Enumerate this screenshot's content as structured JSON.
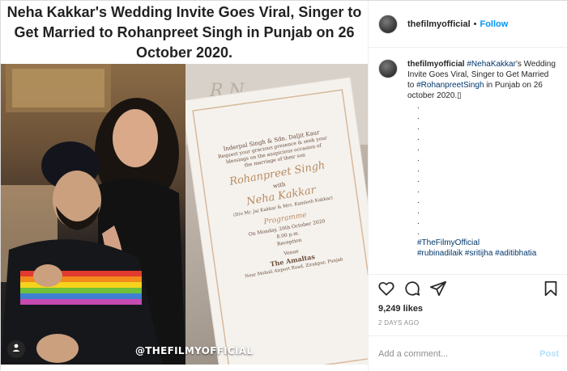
{
  "post": {
    "headline": "Neha Kakkar's Wedding Invite Goes Viral, Singer to Get Married to Rohanpreet Singh in Punjab on 26 October 2020.",
    "watermark": "@THEFILMYOFFICIAL",
    "invite_text": {
      "line1": "Inderpal Singh & Sdn. Daljit Kaur",
      "line2": "Request your gracious presence & seek your",
      "line3": "blessings on the auspicious occasion of",
      "line4": "the marriage of their son",
      "groom": "Rohanpreet Singh",
      "with": "with",
      "bride": "Neha Kakkar",
      "bride_parents": "(D/o Mr. Jai Kakkar & Mrs. Kamlesh Kakkar)",
      "programme": "Programme",
      "date_line": "On Monday, 26th October 2020",
      "time": "8.00 p.m.",
      "reception": "Reception",
      "venue_label": "Venue",
      "venue": "The Amaltas",
      "address": "Near Mohali Airport Road, Zirakpur, Punjab"
    }
  },
  "header": {
    "username": "thefilmyofficial",
    "separator": "•",
    "follow_label": "Follow"
  },
  "caption": {
    "username": "thefilmyofficial",
    "hashtag1": "#NehaKakkar",
    "text1": "'s Wedding Invite Goes Viral, Singer to Get Married to ",
    "hashtag2": "#RohanpreetSingh",
    "text2": " in Punjab on 26 october 2020.",
    "emoji_box": "▯",
    "dots": [
      ".",
      ".",
      ".",
      ".",
      ".",
      ".",
      ".",
      ".",
      ".",
      ".",
      ".",
      ".",
      "."
    ],
    "tags_line1": "#TheFilmyOfficial",
    "tags_line2": "#rubinadilaik #sritijha #aditibhatia"
  },
  "stats": {
    "likes": "9,249 likes",
    "date": "2 DAYS AGO"
  },
  "comment": {
    "placeholder": "Add a comment...",
    "post_label": "Post"
  },
  "icons": {
    "like": "heart-icon",
    "comment": "comment-icon",
    "share": "share-icon",
    "save": "bookmark-icon",
    "tag": "user-tag-icon"
  },
  "colors": {
    "link": "#00376b",
    "follow": "#0095f6",
    "post_disabled": "#b2dffc",
    "muted": "#8e8e8e"
  }
}
